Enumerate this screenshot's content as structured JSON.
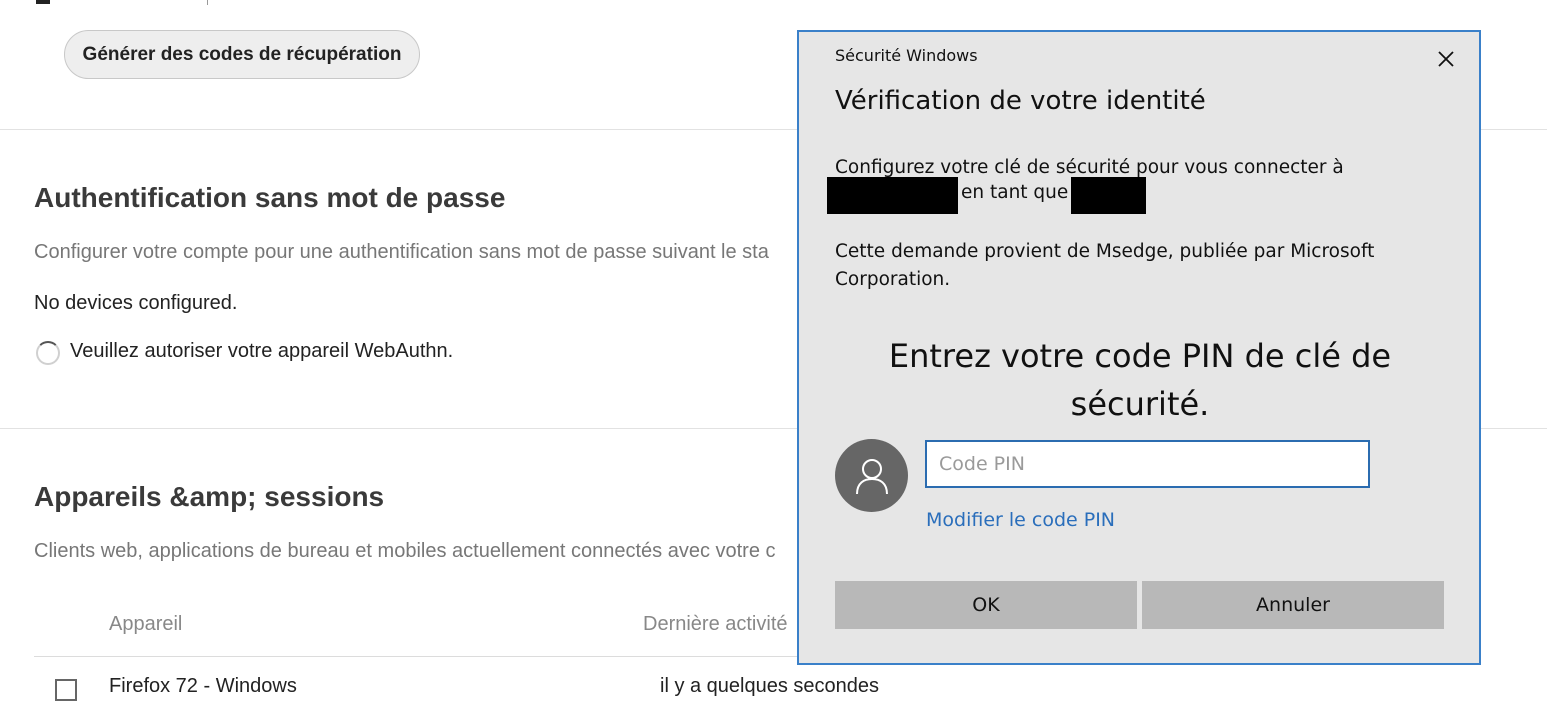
{
  "page": {
    "generate_codes_button": "Générer des codes de récupération",
    "passwordless": {
      "title": "Authentification sans mot de passe",
      "description": "Configurer votre compte pour une authentification sans mot de passe suivant le sta",
      "status": "No devices configured.",
      "authorize_message": "Veuillez autoriser votre appareil WebAuthn."
    },
    "devices": {
      "title": "Appareils &amp; sessions",
      "description": "Clients web, applications de bureau et mobiles actuellement connectés avec votre c",
      "columns": [
        "Appareil",
        "Dernière activité"
      ],
      "first_row": {
        "device": "Firefox 72 - Windows",
        "activity": "il y a quelques secondes"
      }
    }
  },
  "dialog": {
    "app_name": "Sécurité Windows",
    "title": "Vérification de votre identité",
    "instruction_line1": "Configurez votre clé de sécurité pour vous connecter à",
    "instruction_as": "en tant que",
    "source_text": "Cette demande provient de Msedge, publiée par Microsoft Corporation.",
    "pin_prompt": "Entrez votre code PIN de clé de sécurité.",
    "pin_placeholder": "Code PIN",
    "change_pin_link": "Modifier le code PIN",
    "ok_button": "OK",
    "cancel_button": "Annuler",
    "accent_color": "#3a80c9"
  }
}
